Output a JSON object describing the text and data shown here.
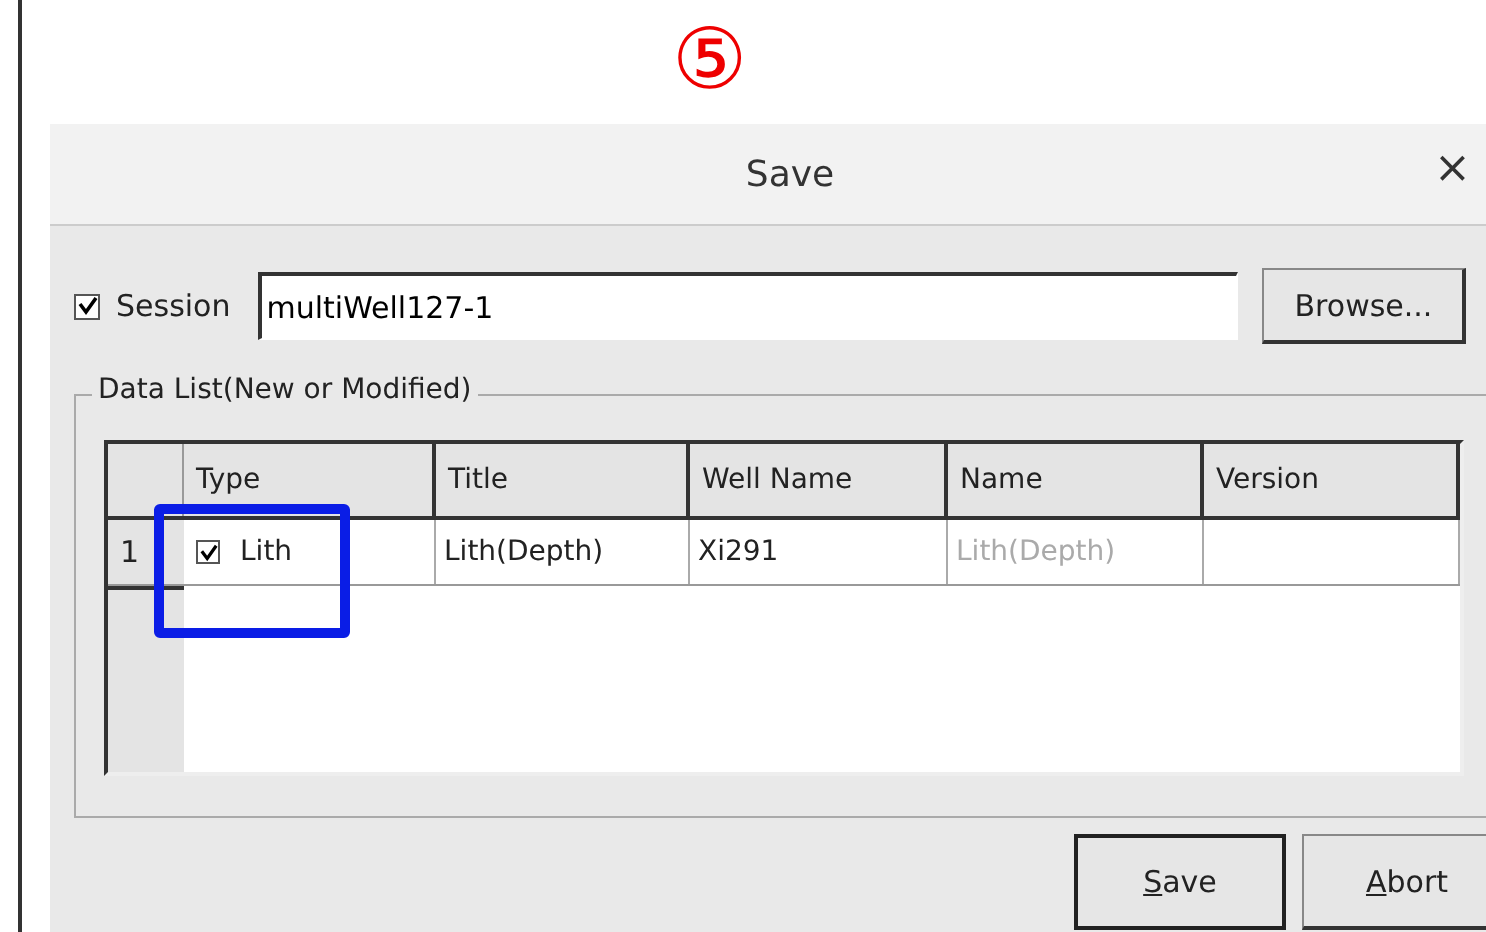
{
  "annotation": {
    "label": "⑤"
  },
  "dialog": {
    "title": "Save",
    "close": "×",
    "session": {
      "label": "Session",
      "checked": true,
      "value": "multiWell127-1",
      "browse": "Browse..."
    },
    "group": {
      "title": "Data List(New or Modified)",
      "table": {
        "columns": [
          "Type",
          "Title",
          "Well Name",
          "Name",
          "Version"
        ],
        "rows": [
          {
            "index": "1",
            "checked": true,
            "type": "Lith",
            "title": "Lith(Depth)",
            "well_name": "Xi291",
            "name": "Lith(Depth)",
            "name_dimmed": true
          }
        ]
      }
    },
    "buttons": [
      "Save",
      "Abort"
    ]
  }
}
